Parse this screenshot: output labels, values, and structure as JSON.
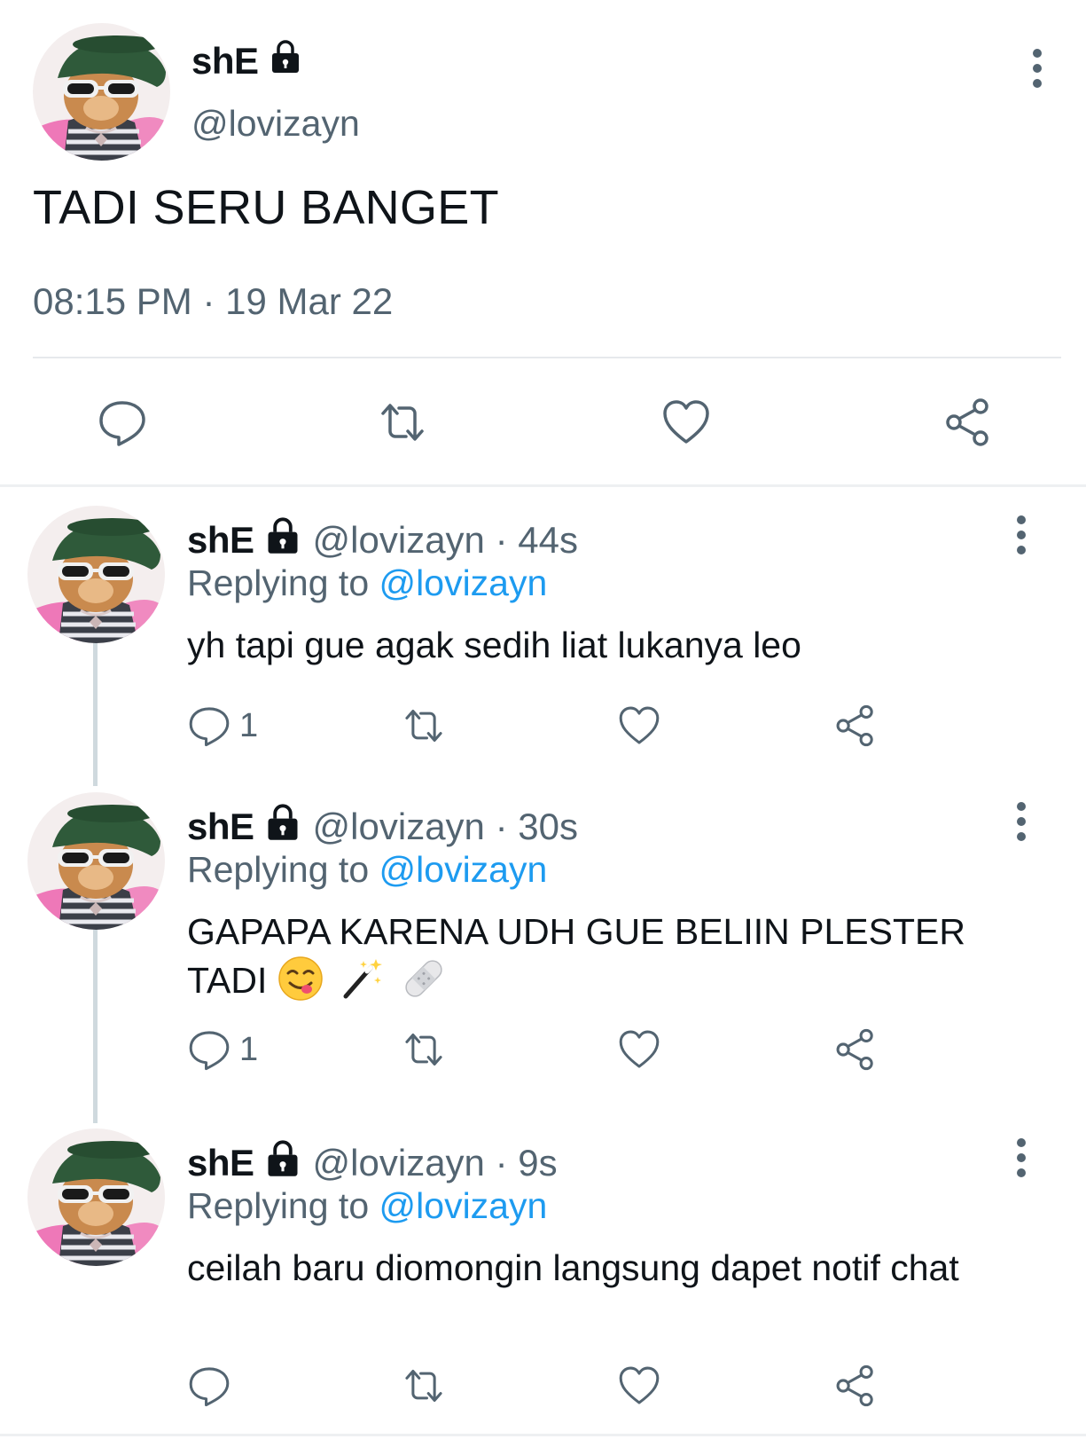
{
  "main_tweet": {
    "display_name": "shE",
    "handle": "@lovizayn",
    "text": "TADI SERU BANGET",
    "timestamp": "08:15 PM · 19 Mar 22",
    "icons": [
      "lock-icon",
      "more-icon",
      "reply-icon",
      "retweet-icon",
      "like-icon",
      "share-icon"
    ]
  },
  "replies": [
    {
      "display_name": "shE",
      "handle_time": "@lovizayn · 44s",
      "replying_prefix": "Replying to",
      "replying_to": "@lovizayn",
      "text": "yh tapi gue agak sedih liat lukanya leo",
      "reply_count": "1",
      "emojis": []
    },
    {
      "display_name": "shE",
      "handle_time": "@lovizayn · 30s",
      "replying_prefix": "Replying to",
      "replying_to": "@lovizayn",
      "text_line1": "GAPAPA KARENA UDH GUE BELIIN PLESTER",
      "text_line2": "TADI",
      "reply_count": "1",
      "emojis": [
        "yum-face-emoji",
        "magic-wand-emoji",
        "bandage-emoji"
      ]
    },
    {
      "display_name": "shE",
      "handle_time": "@lovizayn · 9s",
      "replying_prefix": "Replying to",
      "replying_to": "@lovizayn",
      "text": "ceilah baru diomongin langsung dapet notif chat",
      "reply_count": "",
      "emojis": []
    }
  ],
  "colors": {
    "text": "#0f1419",
    "secondary": "#536471",
    "mention": "#1d9bf0",
    "divider": "#e6e9ec",
    "thread_line": "#cfd9de"
  }
}
